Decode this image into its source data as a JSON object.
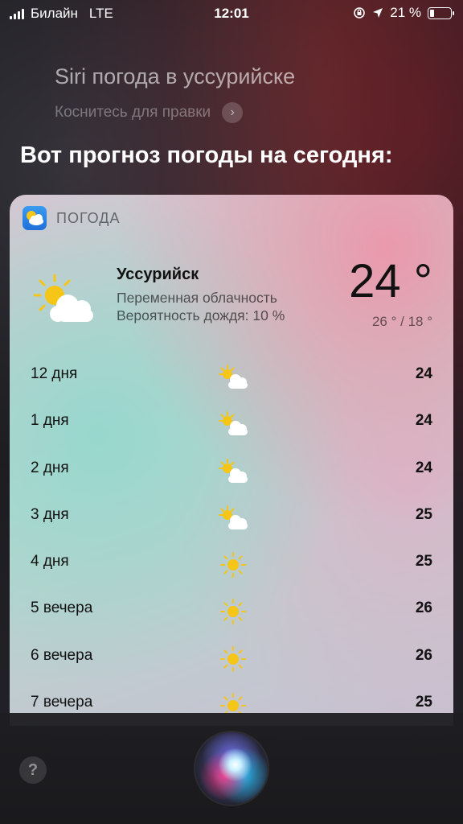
{
  "status_bar": {
    "carrier": "Билайн",
    "network": "LTE",
    "time": "12:01",
    "battery": "21 %"
  },
  "siri": {
    "query": "Siri погода в уссурийске",
    "edit_hint": "Коснитесь для правки",
    "answer": "Вот прогноз погоды на сегодня:"
  },
  "card": {
    "app_label": "ПОГОДА",
    "city": "Уссурийск",
    "condition": "Переменная облачность",
    "rain_chance": "Вероятность дождя: 10 %",
    "temperature": "24 °",
    "range": "26 ° / 18 °",
    "hourly": [
      {
        "hour": "12 дня",
        "icon": "partly-cloudy-icon",
        "temp": "24"
      },
      {
        "hour": "1 дня",
        "icon": "partly-cloudy-icon",
        "temp": "24"
      },
      {
        "hour": "2 дня",
        "icon": "partly-cloudy-icon",
        "temp": "24"
      },
      {
        "hour": "3 дня",
        "icon": "partly-cloudy-icon",
        "temp": "25"
      },
      {
        "hour": "4 дня",
        "icon": "sun-icon",
        "temp": "25"
      },
      {
        "hour": "5 вечера",
        "icon": "sun-icon",
        "temp": "26"
      },
      {
        "hour": "6 вечера",
        "icon": "sun-icon",
        "temp": "26"
      },
      {
        "hour": "7 вечера",
        "icon": "sun-icon",
        "temp": "25"
      }
    ]
  },
  "bottom": {
    "help_label": "?"
  },
  "colors": {
    "sun": "#f5c518",
    "cloud": "#ffffff",
    "app_icon": "#2f86e6"
  }
}
